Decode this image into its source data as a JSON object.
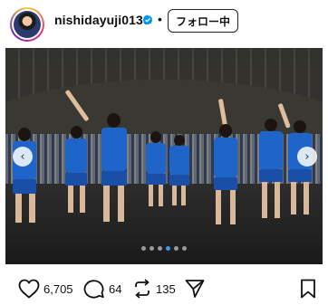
{
  "header": {
    "username": "nishidayuji0130",
    "separator": "•",
    "follow_label": "フォロー中"
  },
  "carousel": {
    "total_slides": 6,
    "active_index": 3,
    "prev_icon": "chevron-left-icon",
    "next_icon": "chevron-right-icon"
  },
  "actions": {
    "likes": "6,705",
    "comments": "64",
    "reposts": "135"
  },
  "colors": {
    "accent": "#3897f0",
    "verified": "#0095f6",
    "jersey": "#1f64c8"
  }
}
